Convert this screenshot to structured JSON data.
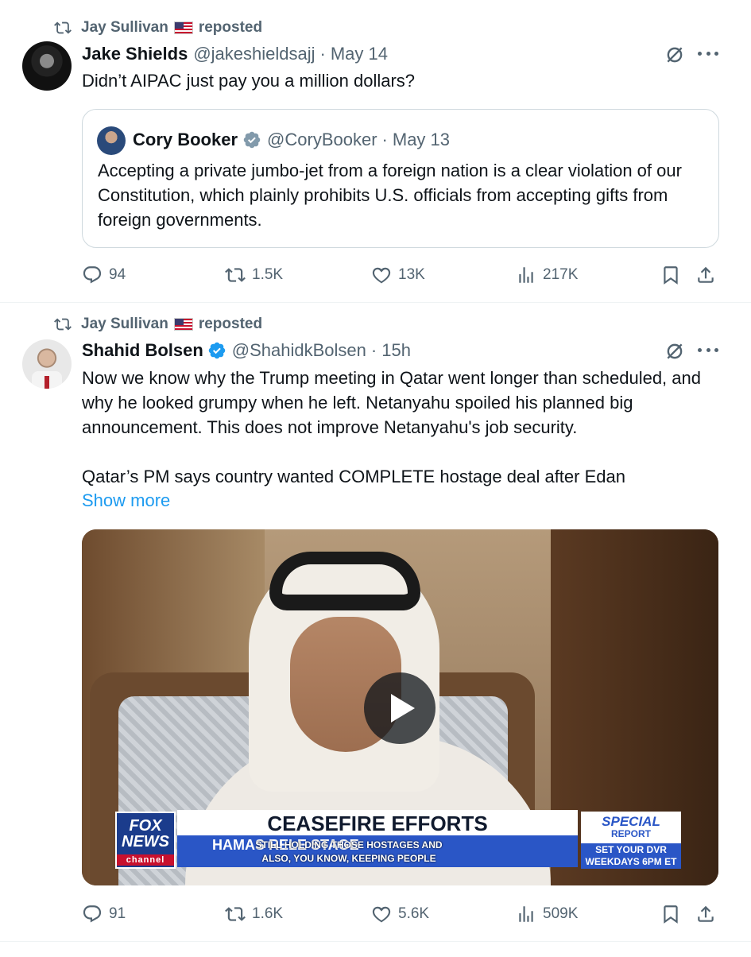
{
  "feed": {
    "tweets": [
      {
        "repost": {
          "user": "Jay Sullivan",
          "label": "reposted"
        },
        "author": {
          "name": "Jake Shields",
          "handle": "@jakeshieldsajj",
          "time": "May 14"
        },
        "text": "Didn’t AIPAC just pay you a million dollars?",
        "quote": {
          "author": {
            "name": "Cory Booker",
            "handle": "@CoryBooker",
            "time": "May 13",
            "verified": true
          },
          "text": "Accepting a private jumbo-jet from a foreign nation is a clear violation of our Constitution, which plainly prohibits U.S. officials from accepting gifts from foreign governments."
        },
        "metrics": {
          "replies": "94",
          "reposts": "1.5K",
          "likes": "13K",
          "views": "217K"
        }
      },
      {
        "repost": {
          "user": "Jay Sullivan",
          "label": "reposted"
        },
        "author": {
          "name": "Shahid Bolsen",
          "handle": "@ShahidkBolsen",
          "time": "15h",
          "verified": true
        },
        "text_p1": "Now we know why the Trump meeting in Qatar went longer than scheduled, and why he looked grumpy when he left.  Netanyahu spoiled his planned big announcement.  This does not improve Netanyahu's job security.",
        "text_p2": "Qatar’s PM says country wanted COMPLETE hostage deal after Edan",
        "show_more": "Show more",
        "video": {
          "headline": "CEASEFIRE EFFORTS",
          "subline": "HAMAS RELE               STAGE",
          "caption_line1": "STILL HOLDING THOSE HOSTAGES AND",
          "caption_line2": "ALSO, YOU KNOW, KEEPING PEOPLE",
          "network_line1": "FOX",
          "network_line2": "NEWS",
          "network_line3": "channel",
          "show_name_line1": "SPECIAL",
          "show_name_line2": "REPORT",
          "dvr_line1": "SET YOUR DVR",
          "dvr_line2": "WEEKDAYS 6PM ET"
        },
        "metrics": {
          "replies": "91",
          "reposts": "1.6K",
          "likes": "5.6K",
          "views": "509K"
        }
      }
    ]
  },
  "colors": {
    "text": "#0f1419",
    "secondary": "#536471",
    "link": "#1d9bf0",
    "border": "#cfd9de",
    "verified": "#1d9bf0"
  },
  "icons": [
    "repost-icon",
    "flag-us-icon",
    "verified-badge-icon",
    "grok-icon",
    "more-icon",
    "reply-icon",
    "like-icon",
    "views-icon",
    "bookmark-icon",
    "share-icon",
    "play-icon"
  ]
}
